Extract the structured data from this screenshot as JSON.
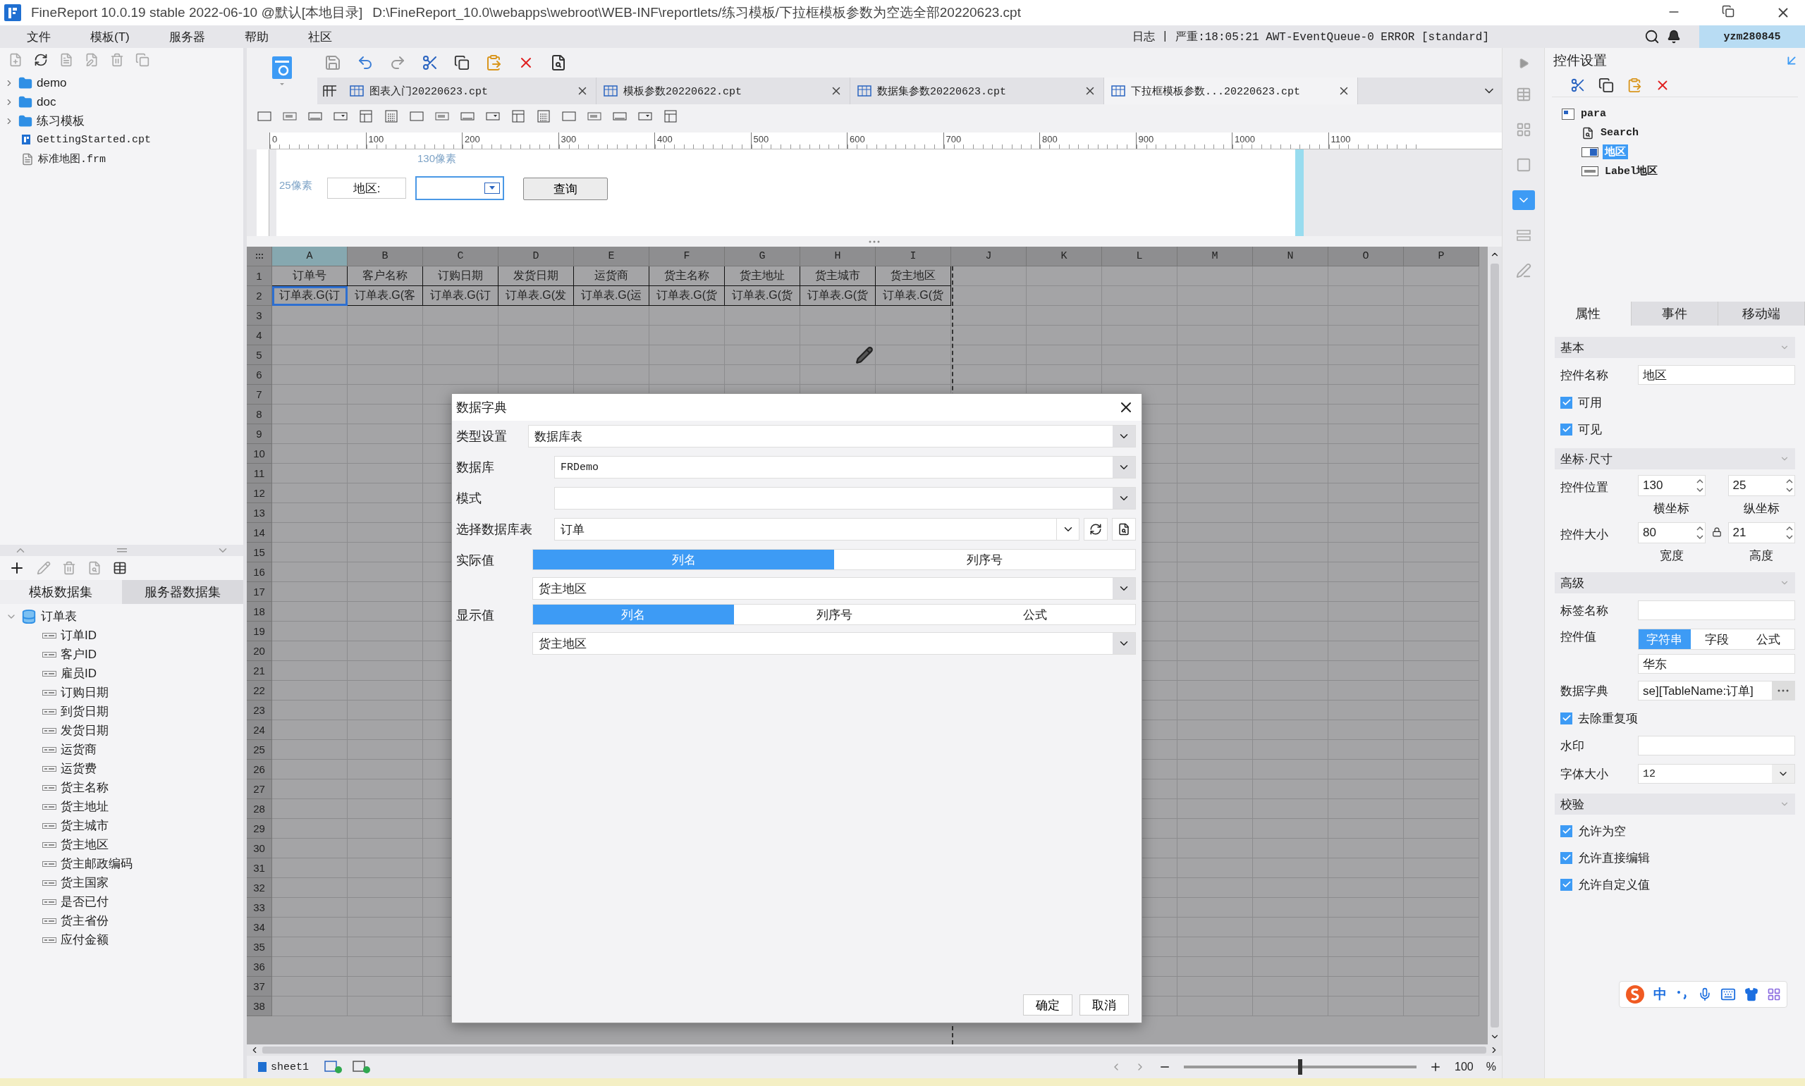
{
  "title_bar": {
    "app": "FineReport 10.0.19 stable 2022-06-10 @默认[本地目录]",
    "path": "D:\\FineReport_10.0\\webapps\\webroot\\WEB-INF\\reportlets/练习模板/下拉框模板参数为空选全部20220623.cpt"
  },
  "menu": [
    "文件",
    "模板(T)",
    "服务器",
    "帮助",
    "社区"
  ],
  "status": {
    "log": "日志",
    "separator": "|",
    "message": "严重:18:05:21 AWT-EventQueue-0 ERROR [standard]",
    "user": "yzm280845"
  },
  "file_tree": [
    {
      "label": "demo",
      "kind": "folder"
    },
    {
      "label": "doc",
      "kind": "folder"
    },
    {
      "label": "练习模板",
      "kind": "folder"
    },
    {
      "label": "GettingStarted.cpt",
      "kind": "report"
    },
    {
      "label": "标准地图.frm",
      "kind": "form"
    }
  ],
  "dataset_tabs": [
    {
      "label": "模板数据集",
      "selected": true
    },
    {
      "label": "服务器数据集",
      "selected": false
    }
  ],
  "dataset_tree": {
    "label": "订单表",
    "expanded": true,
    "children": [
      {
        "label": "订单ID"
      },
      {
        "label": "客户ID"
      },
      {
        "label": "雇员ID"
      },
      {
        "label": "订购日期"
      },
      {
        "label": "到货日期"
      },
      {
        "label": "发货日期"
      },
      {
        "label": "运货商"
      },
      {
        "label": "运货费"
      },
      {
        "label": "货主名称"
      },
      {
        "label": "货主地址"
      },
      {
        "label": "货主城市"
      },
      {
        "label": "货主地区"
      },
      {
        "label": "货主邮政编码"
      },
      {
        "label": "货主国家"
      },
      {
        "label": "是否已付"
      },
      {
        "label": "货主省份"
      },
      {
        "label": "应付金额"
      }
    ]
  },
  "template_tabs": [
    {
      "label": "图表入门20220623.cpt",
      "selected": false
    },
    {
      "label": "模板参数20220622.cpt",
      "selected": false
    },
    {
      "label": "数据集参数20220623.cpt",
      "selected": false
    },
    {
      "label": "下拉框模板参数...20220623.cpt",
      "selected": true
    }
  ],
  "param_canvas": {
    "ruler": [
      "0",
      "100",
      "200",
      "300",
      "400",
      "500",
      "600",
      "700",
      "800",
      "900",
      "1000",
      "1100"
    ],
    "x_offset": "130像素",
    "y_offset": "25像素",
    "label": "地区:",
    "button": "查询"
  },
  "grid": {
    "columns": [
      {
        "label": "A",
        "selected": true
      },
      {
        "label": "B",
        "selected": false
      },
      {
        "label": "C",
        "selected": false
      },
      {
        "label": "D",
        "selected": false
      },
      {
        "label": "E",
        "selected": false
      },
      {
        "label": "F",
        "selected": false
      },
      {
        "label": "G",
        "selected": false
      },
      {
        "label": "H",
        "selected": false
      },
      {
        "label": "I",
        "selected": false
      },
      {
        "label": "J",
        "selected": false
      },
      {
        "label": "K",
        "selected": false
      },
      {
        "label": "L",
        "selected": false
      },
      {
        "label": "M",
        "selected": false
      },
      {
        "label": "N",
        "selected": false
      },
      {
        "label": "O",
        "selected": false
      },
      {
        "label": "P",
        "selected": false
      }
    ],
    "rows": [
      {
        "label": "1",
        "cells": [
          {
            "text": "订单号",
            "selected": false
          },
          {
            "text": "客户名称",
            "selected": false
          },
          {
            "text": "订购日期",
            "selected": false
          },
          {
            "text": "发货日期",
            "selected": false
          },
          {
            "text": "运货商",
            "selected": false
          },
          {
            "text": "货主名称",
            "selected": false
          },
          {
            "text": "货主地址",
            "selected": false
          },
          {
            "text": "货主城市",
            "selected": false
          },
          {
            "text": "货主地区",
            "selected": false
          }
        ]
      },
      {
        "label": "2",
        "cells": [
          {
            "text": "订单表.G(订",
            "selected": true
          },
          {
            "text": "订单表.G(客",
            "selected": false
          },
          {
            "text": "订单表.G(订",
            "selected": false
          },
          {
            "text": "订单表.G(发",
            "selected": false
          },
          {
            "text": "订单表.G(运",
            "selected": false
          },
          {
            "text": "订单表.G(货",
            "selected": false
          },
          {
            "text": "订单表.G(货",
            "selected": false
          },
          {
            "text": "订单表.G(货",
            "selected": false
          },
          {
            "text": "订单表.G(货",
            "selected": false
          }
        ]
      },
      {
        "label": "3"
      },
      {
        "label": "4"
      },
      {
        "label": "5"
      },
      {
        "label": "6"
      },
      {
        "label": "7"
      },
      {
        "label": "8"
      },
      {
        "label": "9"
      },
      {
        "label": "10"
      },
      {
        "label": "11"
      },
      {
        "label": "12"
      },
      {
        "label": "13"
      },
      {
        "label": "14"
      },
      {
        "label": "15"
      },
      {
        "label": "16"
      },
      {
        "label": "17"
      },
      {
        "label": "18"
      },
      {
        "label": "19"
      },
      {
        "label": "20"
      },
      {
        "label": "21"
      },
      {
        "label": "22"
      },
      {
        "label": "23"
      },
      {
        "label": "24"
      },
      {
        "label": "25"
      },
      {
        "label": "26"
      },
      {
        "label": "27"
      },
      {
        "label": "28"
      },
      {
        "label": "29"
      },
      {
        "label": "30"
      },
      {
        "label": "31"
      },
      {
        "label": "32"
      },
      {
        "label": "33"
      },
      {
        "label": "34"
      },
      {
        "label": "35"
      },
      {
        "label": "36"
      },
      {
        "label": "37"
      },
      {
        "label": "38"
      }
    ]
  },
  "sheet_bar": {
    "tab": "sheet1",
    "zoom": "100",
    "unit": "%",
    "level": 0.5
  },
  "dialog": {
    "title": "数据字典",
    "type": {
      "label": "类型设置",
      "value": "数据库表"
    },
    "database": {
      "label": "数据库",
      "value": "FRDemo"
    },
    "schema": {
      "label": "模式"
    },
    "table": {
      "label": "选择数据库表",
      "value": "订单"
    },
    "actual": {
      "label": "实际值",
      "options": [
        {
          "label": "列名",
          "selected": true
        },
        {
          "label": "列序号",
          "selected": false
        }
      ],
      "value": "货主地区"
    },
    "display": {
      "label": "显示值",
      "options": [
        {
          "label": "列名",
          "selected": true
        },
        {
          "label": "列序号",
          "selected": false
        },
        {
          "label": "公式",
          "selected": false
        }
      ],
      "value": "货主地区"
    },
    "buttons": [
      "确定",
      "取消"
    ]
  },
  "widget_settings": {
    "title": "控件设置",
    "tree": {
      "label": "para",
      "children": [
        {
          "label": "Search",
          "kind": "search",
          "selected": false
        },
        {
          "label": "地区",
          "kind": "combo",
          "selected": true
        },
        {
          "label": "Label地区",
          "kind": "label",
          "selected": false
        }
      ]
    }
  },
  "properties": {
    "tabs": [
      {
        "label": "属性",
        "selected": true
      },
      {
        "label": "事件",
        "selected": false
      },
      {
        "label": "移动端",
        "selected": false
      }
    ],
    "sections": [
      {
        "title": "基本",
        "items": [
          {
            "kind": "text",
            "label": "控件名称",
            "value": "地区"
          },
          {
            "kind": "check",
            "label": "可用",
            "checked": true
          },
          {
            "kind": "check",
            "label": "可见",
            "checked": true
          }
        ]
      },
      {
        "title": "坐标·尺寸",
        "items": [
          {
            "kind": "pair",
            "label": "控件位置",
            "fields": [
              {
                "value": "130",
                "caption": "横坐标"
              },
              {
                "value": "25",
                "caption": "纵坐标"
              }
            ]
          },
          {
            "kind": "pair",
            "label": "控件大小",
            "lock": true,
            "fields": [
              {
                "value": "80",
                "caption": "宽度"
              },
              {
                "value": "21",
                "caption": "高度"
              }
            ]
          }
        ]
      },
      {
        "title": "高级",
        "items": [
          {
            "kind": "text",
            "label": "标签名称"
          },
          {
            "kind": "segmented",
            "label": "控件值",
            "options": [
              {
                "label": "字符串",
                "selected": true
              },
              {
                "label": "字段",
                "selected": false
              },
              {
                "label": "公式",
                "selected": false
              }
            ],
            "value": "华东"
          },
          {
            "kind": "more",
            "label": "数据字典",
            "value": "se][TableName:订单]"
          },
          {
            "kind": "check",
            "label": "去除重复项",
            "checked": true
          },
          {
            "kind": "text",
            "label": "水印"
          },
          {
            "kind": "select",
            "label": "字体大小",
            "value": "12"
          }
        ]
      },
      {
        "title": "校验",
        "items": [
          {
            "kind": "check",
            "label": "允许为空",
            "checked": true
          },
          {
            "kind": "check",
            "label": "允许直接编辑",
            "checked": true
          },
          {
            "kind": "check",
            "label": "允许自定义值",
            "checked": true
          }
        ]
      }
    ]
  },
  "ime": {
    "mode": "中"
  }
}
